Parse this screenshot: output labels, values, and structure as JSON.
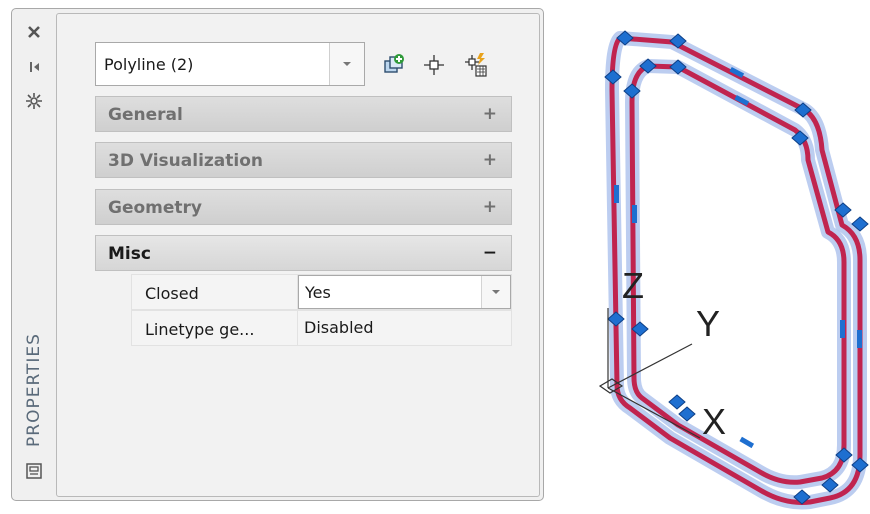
{
  "palette": {
    "title": "PROPERTIES",
    "strip_icons": [
      "close-icon",
      "auto-hide-icon",
      "properties-menu-icon",
      "palette-settings-icon"
    ],
    "selector": {
      "value": "Polyline (2)"
    },
    "toolbar": [
      "toggle-pickadd-icon",
      "select-objects-icon",
      "quick-select-icon"
    ],
    "sections": [
      {
        "label": "General",
        "toggle": "+"
      },
      {
        "label": "3D Visualization",
        "toggle": "+"
      },
      {
        "label": "Geometry",
        "toggle": "+"
      },
      {
        "label": "Misc",
        "toggle": "−"
      }
    ],
    "misc_rows": [
      {
        "name": "Closed",
        "value": "Yes"
      },
      {
        "name": "Linetype ge...",
        "value": "Disabled"
      }
    ]
  },
  "drawing": {
    "ucs": {
      "x_label": "X",
      "y_label": "Y",
      "z_label": "Z"
    },
    "colors": {
      "line": "#c0244f",
      "highlight": "#9fb8ea",
      "grip": "#1e6fd0",
      "accent": "#d23a3a"
    }
  }
}
